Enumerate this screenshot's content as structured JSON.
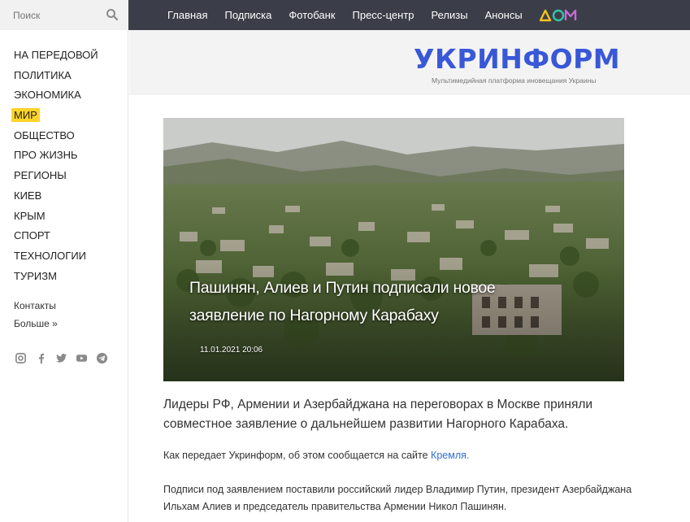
{
  "search": {
    "placeholder": "Поиск"
  },
  "nav": {
    "items": [
      {
        "label": "НА ПЕРЕДОВОЙ"
      },
      {
        "label": "ПОЛИТИКА"
      },
      {
        "label": "ЭКОНОМИКА"
      },
      {
        "label": "МИР",
        "active": true
      },
      {
        "label": "ОБЩЕСТВО"
      },
      {
        "label": "ПРО ЖИЗНЬ"
      },
      {
        "label": "РЕГИОНЫ"
      },
      {
        "label": "КИЕВ"
      },
      {
        "label": "КРЫМ"
      },
      {
        "label": "СПОРТ"
      },
      {
        "label": "ТЕХНОЛОГИИ"
      },
      {
        "label": "ТУРИЗМ"
      }
    ],
    "contacts": "Контакты",
    "more": "Больше »"
  },
  "topbar": {
    "links": [
      "Главная",
      "Подписка",
      "Фотобанк",
      "Пресс-центр",
      "Релизы",
      "Анонсы"
    ]
  },
  "header": {
    "logo": "УКРИНФОРМ",
    "tagline": "Мультимедийная платформа иновещания Украины"
  },
  "article": {
    "title": "Пашинян, Алиев и Путин подписали новое заявление по Нагорному Карабаху",
    "date": "11.01.2021 20:06",
    "lead": "Лидеры РФ, Армении и Азербайджана на переговорах в Москве приняли совместное заявление о дальнейшем развитии Нагорного Карабаха.",
    "p1_text": "Как передает Укринформ, об этом сообщается на сайте ",
    "p1_link": "Кремля.",
    "p2": "Подписи под заявлением поставили российский лидер Владимир Путин, президент Азербайджана Ильхам Алиев и председатель правительства Армении Никол Пашинян."
  },
  "colors": {
    "topbar": "#3b3e48",
    "logo": "#3858d8",
    "active_highlight": "#ffd42a",
    "link": "#2e6fd0"
  },
  "icons": {
    "search": "search-icon",
    "social": [
      "instagram-icon",
      "facebook-icon",
      "twitter-icon",
      "youtube-icon",
      "telegram-icon"
    ]
  }
}
